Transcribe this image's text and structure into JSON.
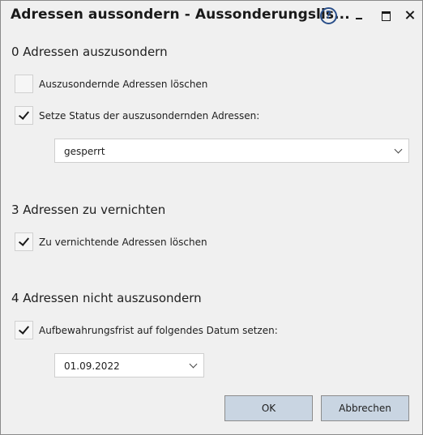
{
  "window": {
    "title": "Adressen aussondern - Aussonderungslis...",
    "help_symbol": "?"
  },
  "section_aussondern": {
    "heading": "0 Adressen auszusondern",
    "delete_checkbox": {
      "label": "Auszusondernde Adressen löschen",
      "checked": false
    },
    "status_checkbox": {
      "label": "Setze Status der auszusondernden Adressen:",
      "checked": true
    },
    "status_select": {
      "value": "gesperrt"
    }
  },
  "section_vernichten": {
    "heading": "3 Adressen zu vernichten",
    "delete_checkbox": {
      "label": "Zu vernichtende Adressen löschen",
      "checked": true
    }
  },
  "section_nicht_aussondern": {
    "heading": "4 Adressen nicht auszusondern",
    "retention_checkbox": {
      "label": "Aufbewahrungsfrist auf folgendes Datum setzen:",
      "checked": true
    },
    "date_select": {
      "value": "01.09.2022"
    }
  },
  "buttons": {
    "ok": "OK",
    "cancel": "Abbrechen"
  },
  "icons": {
    "help": "help-icon",
    "minimize": "minimize-icon",
    "maximize": "maximize-icon",
    "close": "close-icon",
    "dropdown": "chevron-down-icon",
    "check": "checkmark-icon"
  },
  "colors": {
    "background": "#f0f0f0",
    "button": "#c9d5e2",
    "help_icon": "#2a4f8a",
    "input_background": "#ffffff"
  }
}
